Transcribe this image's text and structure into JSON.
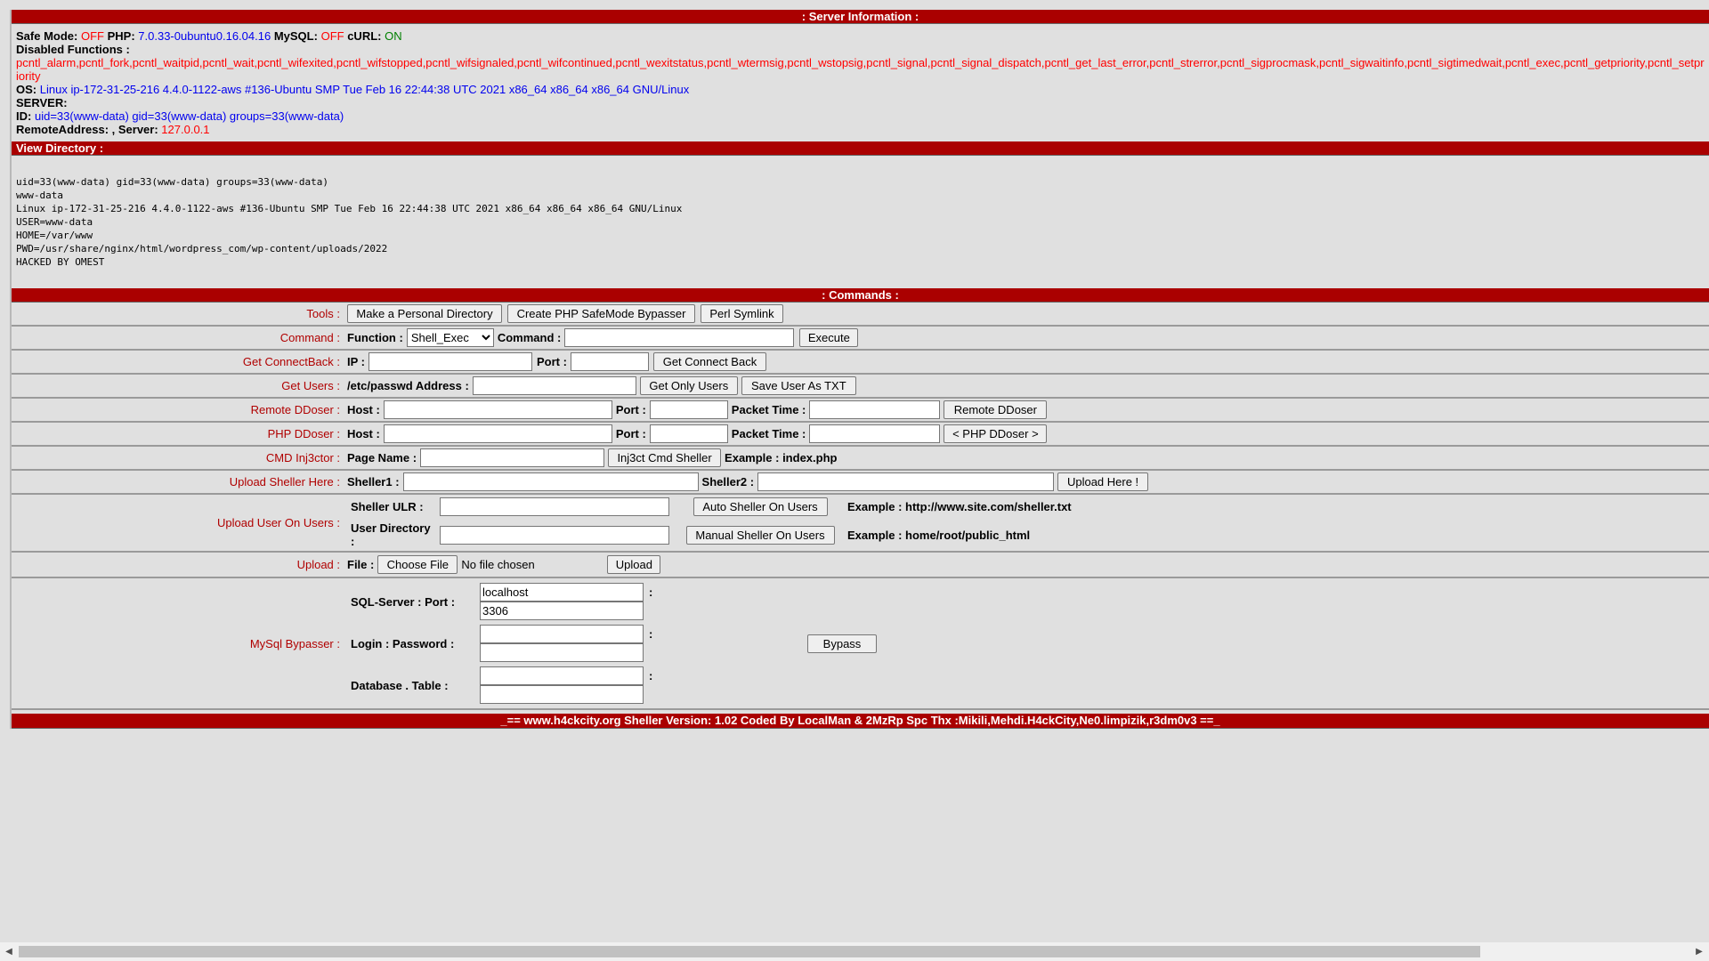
{
  "server_info": {
    "title": ": Server Information :",
    "safe_mode_label": "Safe Mode:",
    "safe_mode": "OFF",
    "php_label": "PHP:",
    "php": "7.0.33-0ubuntu0.16.04.16",
    "mysql_label": "MySQL:",
    "mysql": "OFF",
    "curl_label": "cURL:",
    "curl": "ON",
    "disabled_label": "Disabled Functions :",
    "disabled": "pcntl_alarm,pcntl_fork,pcntl_waitpid,pcntl_wait,pcntl_wifexited,pcntl_wifstopped,pcntl_wifsignaled,pcntl_wifcontinued,pcntl_wexitstatus,pcntl_wtermsig,pcntl_wstopsig,pcntl_signal,pcntl_signal_dispatch,pcntl_get_last_error,pcntl_strerror,pcntl_sigprocmask,pcntl_sigwaitinfo,pcntl_sigtimedwait,pcntl_exec,pcntl_getpriority,pcntl_setpriority",
    "os_label": "OS:",
    "os": "Linux ip-172-31-25-216 4.4.0-1122-aws #136-Ubuntu SMP Tue Feb 16 22:44:38 UTC 2021 x86_64 x86_64 x86_64 GNU/Linux",
    "server_label": "SERVER:",
    "id_label": "ID:",
    "id": "uid=33(www-data) gid=33(www-data) groups=33(www-data)",
    "remote_label": "RemoteAddress: , Server:",
    "server_ip": "127.0.0.1"
  },
  "view_dir": {
    "title": "View Directory :",
    "output": "uid=33(www-data) gid=33(www-data) groups=33(www-data)\nwww-data\nLinux ip-172-31-25-216 4.4.0-1122-aws #136-Ubuntu SMP Tue Feb 16 22:44:38 UTC 2021 x86_64 x86_64 x86_64 GNU/Linux\nUSER=www-data\nHOME=/var/www\nPWD=/usr/share/nginx/html/wordpress_com/wp-content/uploads/2022\nHACKED BY OMEST"
  },
  "commands": {
    "title": ": Commands :",
    "tools": {
      "label": "Tools :",
      "b1": "Make a Personal Directory",
      "b2": "Create PHP SafeMode Bypasser",
      "b3": "Perl Symlink"
    },
    "command": {
      "label": "Command :",
      "function_label": "Function :",
      "function_value": "Shell_Exec",
      "command_label": "Command :",
      "execute": "Execute"
    },
    "connect": {
      "label": "Get ConnectBack :",
      "ip_label": "IP :",
      "port_label": "Port :",
      "button": "Get Connect Back"
    },
    "users": {
      "label": "Get Users :",
      "addr_label": "/etc/passwd Address :",
      "b1": "Get Only Users",
      "b2": "Save User As TXT"
    },
    "remote_ddoser": {
      "label": "Remote DDoser :",
      "host_label": "Host :",
      "port_label": "Port :",
      "packet_label": "Packet Time :",
      "button": "Remote DDoser"
    },
    "php_ddoser": {
      "label": "PHP DDoser :",
      "host_label": "Host :",
      "port_label": "Port :",
      "packet_label": "Packet Time :",
      "button": "< PHP DDoser >"
    },
    "injector": {
      "label": "CMD Inj3ctor :",
      "page_label": "Page Name :",
      "button": "Inj3ct Cmd Sheller",
      "example": "Example : index.php"
    },
    "upload_sheller": {
      "label": "Upload Sheller Here :",
      "s1_label": "Sheller1 :",
      "s2_label": "Sheller2 :",
      "button": "Upload Here !"
    },
    "upload_users": {
      "label": "Upload User On Users :",
      "url_label": "Sheller ULR :",
      "dir_label": "User Directory :",
      "b1": "Auto Sheller On Users",
      "b2": "Manual Sheller On Users",
      "ex1": "Example : http://www.site.com/sheller.txt",
      "ex2": "Example : home/root/public_html"
    },
    "upload": {
      "label": "Upload :",
      "file_label": "File :",
      "choose": "Choose File",
      "no_file": "No file chosen",
      "button": "Upload"
    },
    "mysql": {
      "label": "MySql Bypasser :",
      "server_label": "SQL-Server : Port :",
      "server_value": "localhost",
      "port_value": "3306",
      "login_label": "Login : Password :",
      "db_label": "Database . Table :",
      "colon": ":",
      "button": "Bypass"
    }
  },
  "footer": "_== www.h4ckcity.org Sheller Version: 1.02 Coded By LocalMan & 2MzRp Spc Thx :Mikili,Mehdi.H4ckCity,Ne0.limpizik,r3dm0v3 ==_",
  "colors": {
    "header_bar": "#aa0000",
    "label": "#b00000",
    "background": "#e0e0e0"
  }
}
